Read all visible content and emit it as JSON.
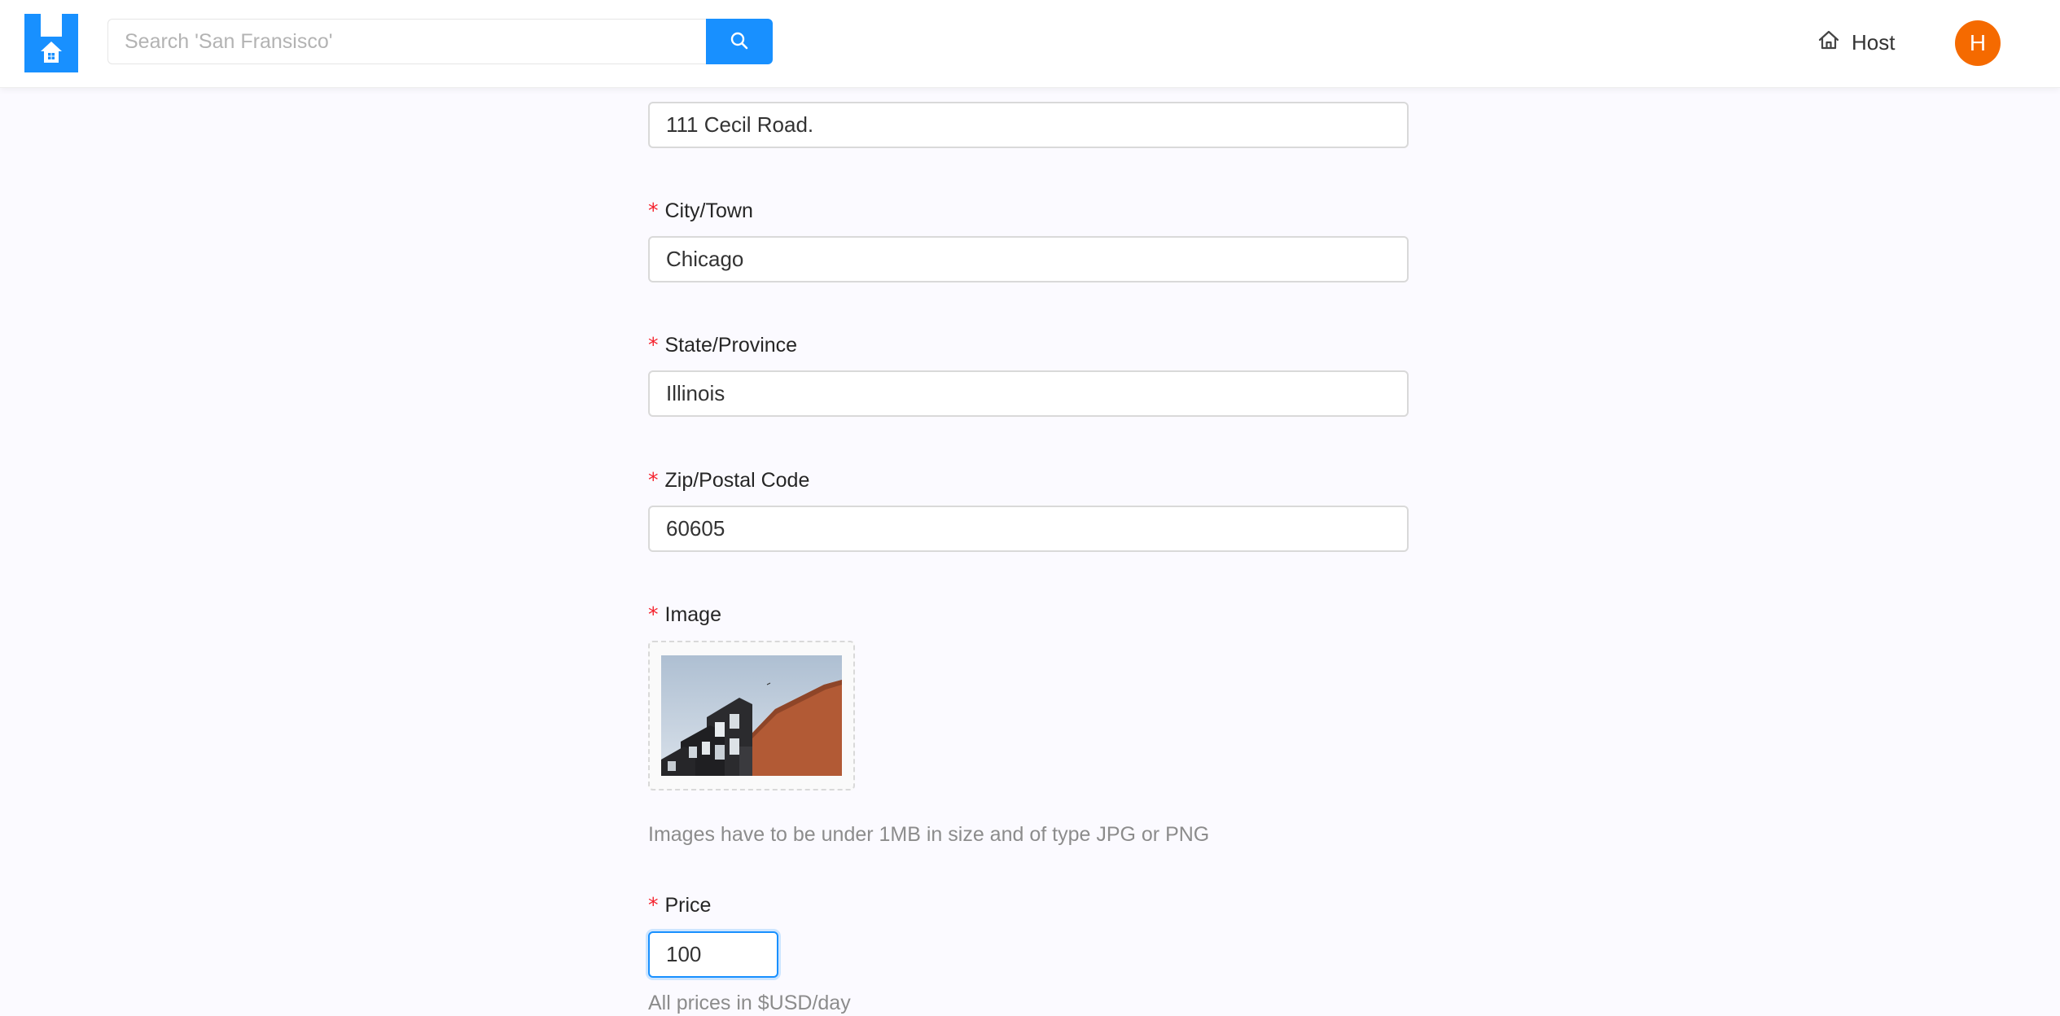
{
  "header": {
    "search": {
      "placeholder": "Search 'San Fransisco'"
    },
    "host_label": "Host",
    "avatar_initial": "H"
  },
  "form": {
    "address": {
      "value": "111 Cecil Road."
    },
    "city": {
      "label": "City/Town",
      "value": "Chicago"
    },
    "state": {
      "label": "State/Province",
      "value": "Illinois"
    },
    "zip": {
      "label": "Zip/Postal Code",
      "value": "60605"
    },
    "image": {
      "label": "Image",
      "help": "Images have to be under 1MB in size and of type JPG or PNG"
    },
    "price": {
      "label": "Price",
      "value": "100",
      "help": "All prices in $USD/day"
    },
    "required_marker": "*"
  },
  "colors": {
    "primary": "#1890ff",
    "avatar_bg": "#f56a00",
    "required": "#f5222d"
  }
}
